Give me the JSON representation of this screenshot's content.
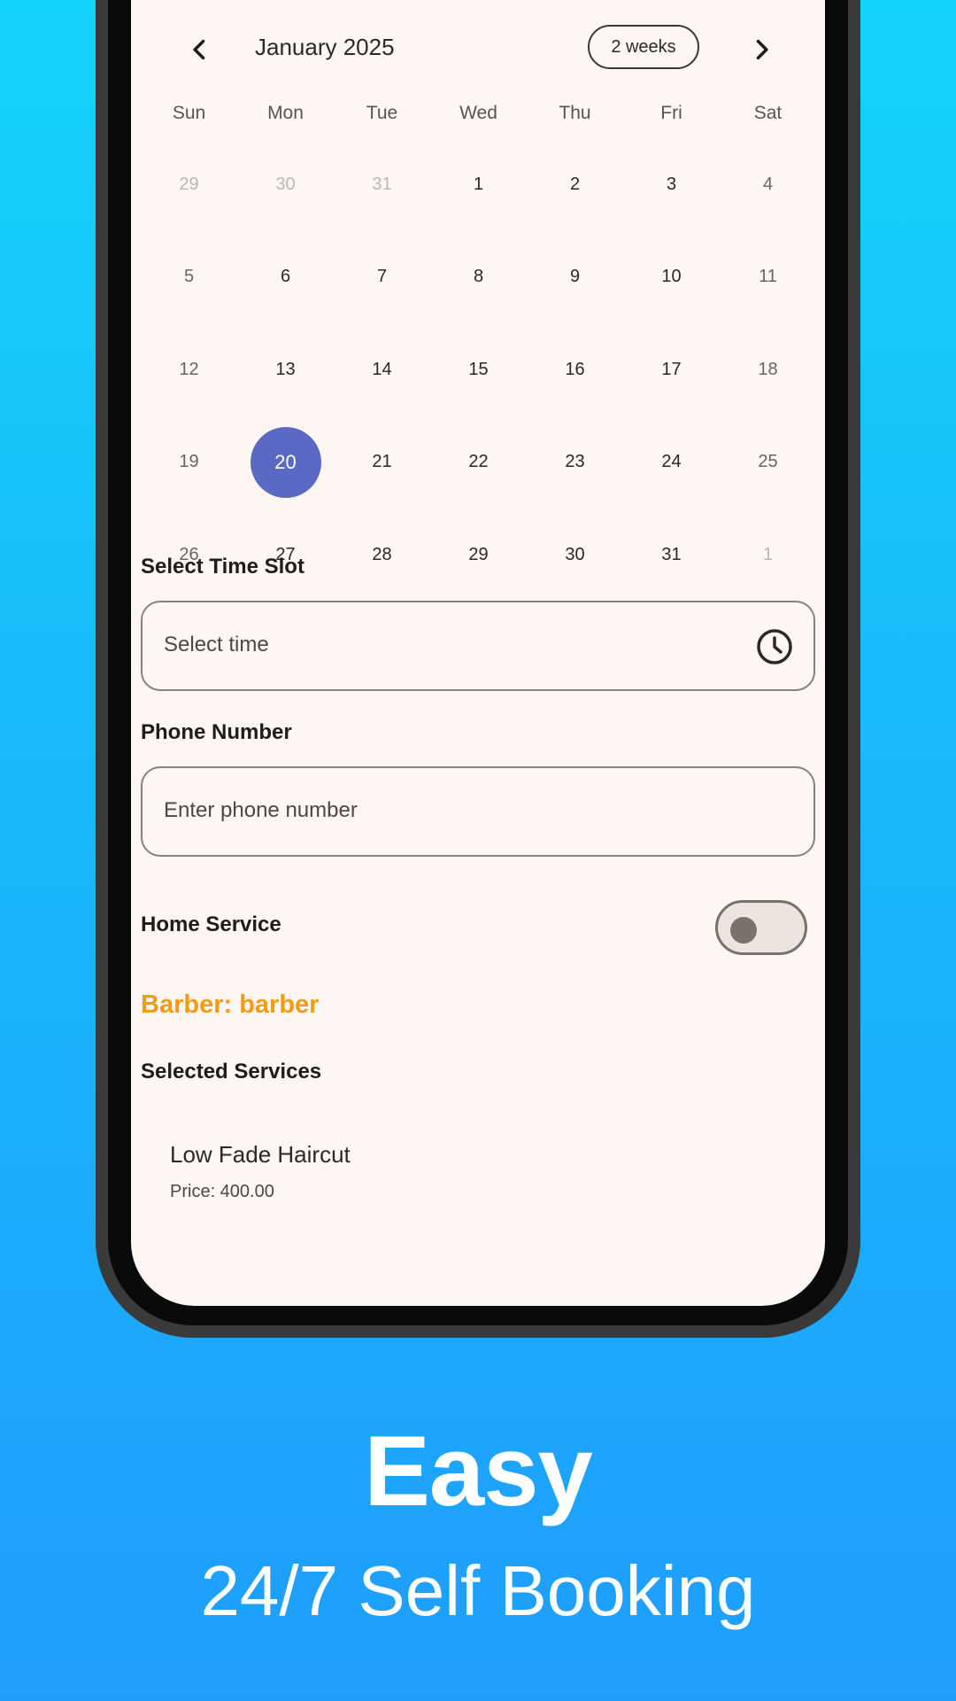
{
  "calendar": {
    "month_label": "January 2025",
    "view_toggle": "2 weeks",
    "weekdays": [
      "Sun",
      "Mon",
      "Tue",
      "Wed",
      "Thu",
      "Fri",
      "Sat"
    ],
    "weeks": [
      [
        "29",
        "30",
        "31",
        "1",
        "2",
        "3",
        "4"
      ],
      [
        "5",
        "6",
        "7",
        "8",
        "9",
        "10",
        "11"
      ],
      [
        "12",
        "13",
        "14",
        "15",
        "16",
        "17",
        "18"
      ],
      [
        "19",
        "20",
        "21",
        "22",
        "23",
        "24",
        "25"
      ],
      [
        "26",
        "27",
        "28",
        "29",
        "30",
        "31",
        "1"
      ]
    ],
    "selected_day": "20",
    "accent_color": "#5a6ac4"
  },
  "time_slot": {
    "label": "Select Time Slot",
    "placeholder": "Select time",
    "icon": "clock-icon"
  },
  "phone": {
    "label": "Phone Number",
    "placeholder": "Enter phone number"
  },
  "home_service": {
    "label": "Home Service",
    "enabled": false
  },
  "barber": {
    "text": "Barber: barber",
    "color": "#f29b16"
  },
  "services": {
    "label": "Selected Services",
    "items": [
      {
        "name": "Low Fade Haircut",
        "price": "Price: 400.00"
      }
    ]
  },
  "promo": {
    "title": "Easy",
    "subtitle": "24/7 Self Booking"
  }
}
